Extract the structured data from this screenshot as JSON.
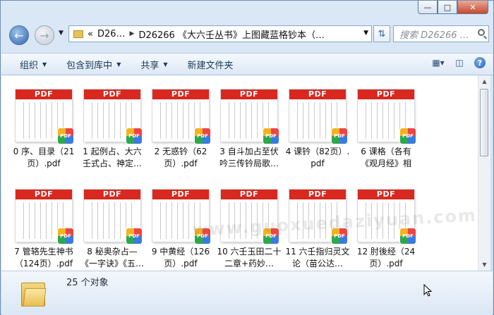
{
  "window": {
    "controls": {
      "minimize": "—",
      "maximize": "□",
      "close": "✕"
    }
  },
  "nav": {
    "back_icon": "back-arrow",
    "forward_icon": "forward-arrow",
    "breadcrumb": {
      "overflow": "«",
      "root": "D26…",
      "current": "D26266 《大六壬丛书》上图藏蓝格钞本（…"
    },
    "search_placeholder": "搜索 D26266 …"
  },
  "toolbar": {
    "organize": "组织",
    "include_library": "包含到库中",
    "share": "共享",
    "new_folder": "新建文件夹"
  },
  "files": [
    {
      "label": "PDF",
      "name": "0 序、目录（21页）.pdf"
    },
    {
      "label": "PDF",
      "name": "1 起例占、大六壬式占、神定…"
    },
    {
      "label": "PDF",
      "name": "2 无惑钤（62页）.pdf"
    },
    {
      "label": "PDF",
      "name": "3 自斗加占至伏吟三传钤局歌…"
    },
    {
      "label": "PDF",
      "name": "4 课钤（82页）.pdf"
    },
    {
      "label": "PDF",
      "name": "6 课格（各有《观月经》相应…"
    },
    {
      "label": "PDF",
      "name": "7 管辂先生神书（124页）.pdf"
    },
    {
      "label": "PDF",
      "name": "8 秘奥杂占—《一字诀》《五…"
    },
    {
      "label": "PDF",
      "name": "9 中黄经（126页）.pdf"
    },
    {
      "label": "PDF",
      "name": "10 六壬玉田二十二章+药妙…"
    },
    {
      "label": "PDF",
      "name": "11 六壬指归灵文论（苗公达…"
    },
    {
      "label": "PDF",
      "name": "12 肘後经（24页）.pdf"
    }
  ],
  "watermark": "www.guoxuedaziyuan.com",
  "status": {
    "count_text": "25 个对象"
  }
}
